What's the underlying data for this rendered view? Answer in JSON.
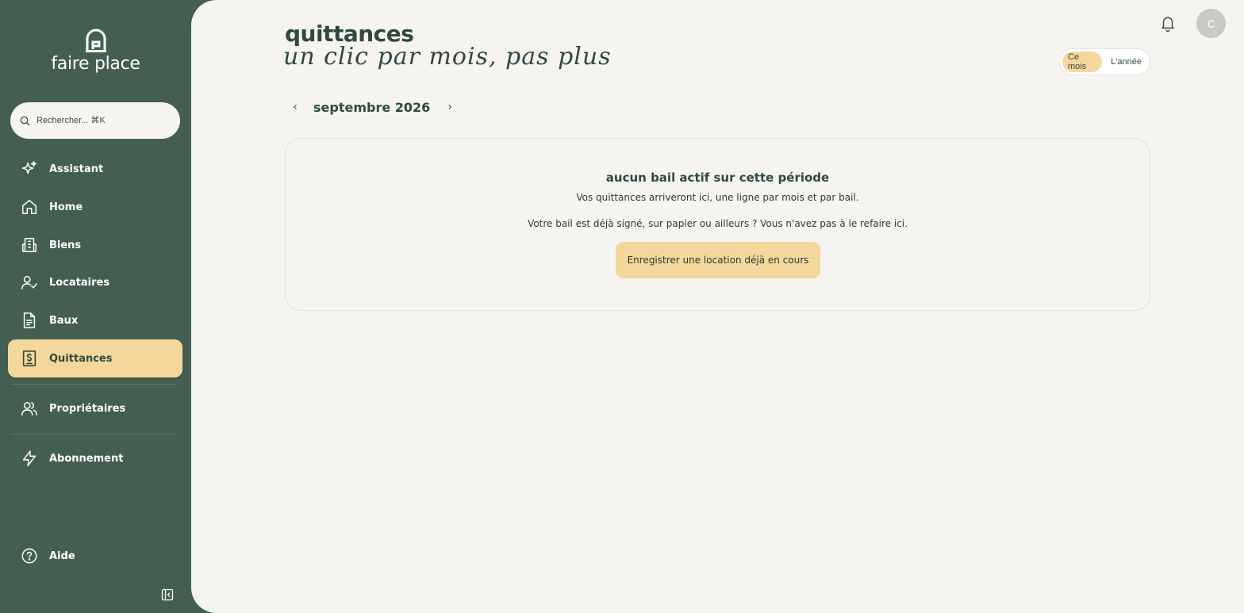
{
  "brand": {
    "name": "faire place"
  },
  "search": {
    "placeholder": "Rechercher... ⌘K"
  },
  "nav": {
    "items": [
      {
        "label": "Assistant",
        "icon": "sparkles-icon"
      },
      {
        "label": "Home",
        "icon": "home-icon"
      },
      {
        "label": "Biens",
        "icon": "building-icon"
      },
      {
        "label": "Locataires",
        "icon": "user-check-icon"
      },
      {
        "label": "Baux",
        "icon": "document-icon"
      },
      {
        "label": "Quittances",
        "icon": "receipt-dollar-icon",
        "active": true
      },
      {
        "label": "Propriétaires",
        "icon": "users-icon"
      },
      {
        "label": "Abonnement",
        "icon": "lightning-icon"
      }
    ],
    "help": {
      "label": "Aide",
      "icon": "help-circle-icon"
    }
  },
  "header": {
    "title": "quittances",
    "subtitle": "un clic par mois, pas plus",
    "avatar_initial": "C"
  },
  "toggle": {
    "options": [
      "Ce mois",
      "L'année"
    ],
    "selected": "Ce mois"
  },
  "period": {
    "label": "septembre 2026",
    "prev": "‹",
    "next": "›"
  },
  "empty": {
    "title": "aucun bail actif sur cette période",
    "line1": "Vos quittances arriveront ici, une ligne par mois et par bail.",
    "line2": "Votre bail est déjà signé, sur papier ou ailleurs ? Vous n'avez pas à le refaire ici.",
    "cta": "Enregistrer une location déjà en cours"
  },
  "colors": {
    "sidebar": "#445f52",
    "background": "#f6f4f0",
    "accent": "#f4d79b",
    "text_dark": "#2f4a3d"
  }
}
